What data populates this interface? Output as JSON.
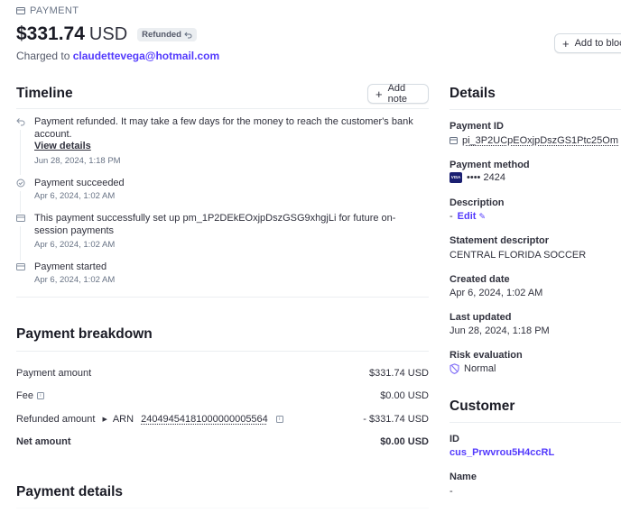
{
  "header": {
    "section_label": "PAYMENT",
    "amount": "$331.74",
    "currency": "USD",
    "status_badge": "Refunded",
    "charged_prefix": "Charged to",
    "customer_email": "claudettevega@hotmail.com",
    "add_block_label": "Add to bloc"
  },
  "timeline": {
    "title": "Timeline",
    "add_note_label": "Add note",
    "events": [
      {
        "text": "Payment refunded. It may take a few days for the money to reach the customer's bank account.",
        "link": "View details",
        "time": "Jun 28, 2024, 1:18 PM",
        "icon": "refund-icon"
      },
      {
        "text": "Payment succeeded",
        "time": "Apr 6, 2024, 1:02 AM",
        "icon": "check-circle-icon"
      },
      {
        "text": "This payment successfully set up pm_1P2DEkEOxjpDszGSG9xhgjLi for future on-session payments",
        "time": "Apr 6, 2024, 1:02 AM",
        "icon": "card-icon"
      },
      {
        "text": "Payment started",
        "time": "Apr 6, 2024, 1:02 AM",
        "icon": "payment-icon"
      }
    ]
  },
  "breakdown": {
    "title": "Payment breakdown",
    "rows": [
      {
        "label": "Payment amount",
        "value": "$331.74 USD"
      },
      {
        "label": "Fee",
        "value": "$0.00 USD"
      },
      {
        "label": "Refunded amount",
        "arn_label": "ARN",
        "arn": "24049454181000000005564",
        "value": "- $331.74 USD"
      },
      {
        "label": "Net amount",
        "value": "$0.00 USD"
      }
    ]
  },
  "payment_details": {
    "title": "Payment details"
  },
  "details": {
    "title": "Details",
    "payment_id_label": "Payment ID",
    "payment_id": "pi_3P2UCpEOxjpDszGS1Ptc25Om",
    "payment_method_label": "Payment method",
    "card_brand": "VISA",
    "card_last4": "•••• 2424",
    "description_label": "Description",
    "description_value": "-",
    "edit_label": "Edit",
    "statement_label": "Statement descriptor",
    "statement_value": "CENTRAL FLORIDA SOCCER",
    "created_label": "Created date",
    "created_value": "Apr 6, 2024, 1:02 AM",
    "updated_label": "Last updated",
    "updated_value": "Jun 28, 2024, 1:18 PM",
    "risk_label": "Risk evaluation",
    "risk_value": "Normal"
  },
  "customer": {
    "title": "Customer",
    "id_label": "ID",
    "id_value": "cus_Prwvrou5H4ccRL",
    "name_label": "Name",
    "name_value": "-"
  },
  "colors": {
    "accent": "#533afd",
    "text": "#30313d",
    "muted": "#687385",
    "divider": "#ebeef1",
    "visa": "#1a1f71"
  }
}
